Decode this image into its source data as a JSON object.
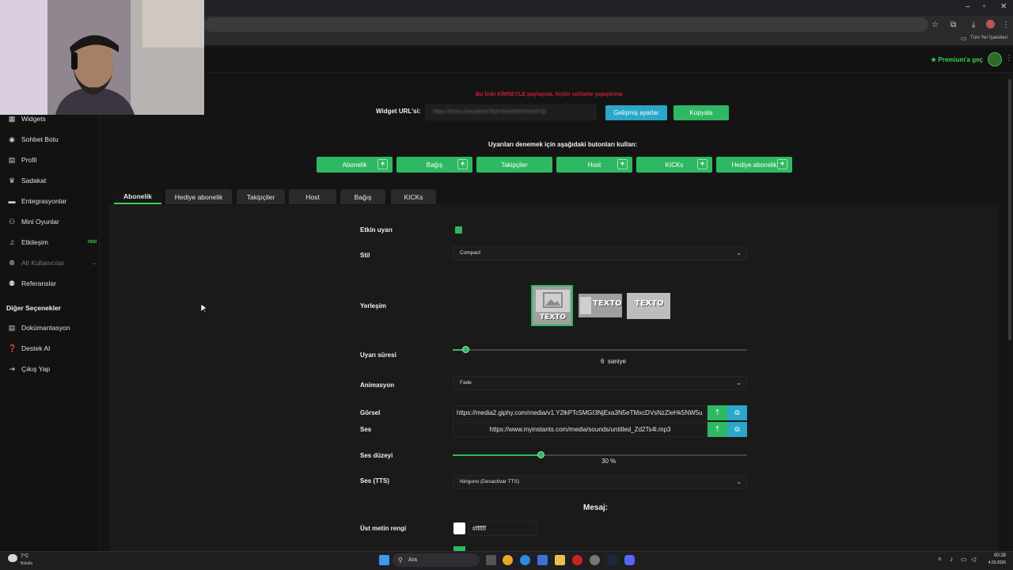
{
  "browser": {
    "bookmarks_label": "Tüm Yer İşaretleri"
  },
  "header": {
    "premium_label": "★ Premium'a geç"
  },
  "sidebar": {
    "items": [
      {
        "label": "Widgets",
        "icon": "grid-icon"
      },
      {
        "label": "Sohbet Botu",
        "icon": "bot-icon"
      },
      {
        "label": "Profil",
        "icon": "profile-card-icon"
      },
      {
        "label": "Sadakat",
        "icon": "trophy-icon"
      },
      {
        "label": "Entegrasyonlar",
        "icon": "integrations-icon"
      },
      {
        "label": "Mini Oyunlar",
        "icon": "gamepad-icon"
      },
      {
        "label": "Etkileşim",
        "icon": "music-note-icon",
        "badge": "YENİ"
      },
      {
        "label": "Alt Kullanıcılar",
        "icon": "users-icon",
        "disabled": true
      },
      {
        "label": "Referanslar",
        "icon": "referrals-icon"
      }
    ],
    "section_title": "Diğer Seçenekler",
    "other_items": [
      {
        "label": "Dokümantasyon",
        "icon": "docs-icon"
      },
      {
        "label": "Destek AI",
        "icon": "help-icon"
      },
      {
        "label": "Çıkış Yap",
        "icon": "logout-icon"
      }
    ]
  },
  "widget": {
    "warning": "Bu linki KİMSEYLE paylaşma, hiçbir sohbete yapıştırma",
    "url_label": "Widget URL'si:",
    "url_value": "https://botrix.live/alerts?bid=KecbMmPrmdYxjt",
    "advanced_button": "Gelişmiş ayarlar",
    "copy_button": "Kopyala",
    "test_label": "Uyarıları denemek için aşağıdaki butonları kullan:",
    "test_buttons": [
      "Abonelik",
      "Bağış",
      "Takipçiler",
      "Host",
      "KICKs",
      "Hediye abonelik"
    ]
  },
  "tabs": [
    "Abonelik",
    "Hediye abonelik",
    "Takipçiler",
    "Host",
    "Bağış",
    "KICKs"
  ],
  "form": {
    "active_label": "Etkin uyarı",
    "active": true,
    "style_label": "Stil",
    "style_value": "Compact",
    "layout_label": "Yerleşim",
    "layout_options": [
      "TEXTO",
      "TEXTO",
      "TEXTO"
    ],
    "duration_label": "Uyarı süresi",
    "duration_value": "6",
    "duration_unit": "saniye",
    "animation_label": "Animasyon",
    "animation_value": "Fade",
    "image_label": "Görsel",
    "image_value": "https://media2.giphy.com/media/v1.Y2lkPTc5MGI3NjExa3N5eTMxcDVsNzZleHk5NW5u",
    "sound_label": "Ses",
    "sound_value": "https://www.myinstants.com/media/sounds/untitled_Zd2Ts4l.mp3",
    "volume_label": "Ses düzeyi",
    "volume_value": "30",
    "volume_unit": "%",
    "volume_fraction": 0.3,
    "tts_label": "Ses (TTS)",
    "tts_value": "Ninguno (Desactivar TTS)",
    "message_title": "Mesaj:",
    "top_text_color_label": "Üst metin rengi",
    "top_text_color_value": "#ffffff"
  },
  "taskbar": {
    "weather_temp": "7°C",
    "weather_desc": "Bulutlu",
    "search_placeholder": "Ara",
    "time": "00:28",
    "date": "4.03.2026"
  },
  "colors": {
    "accent_green": "#2fb862",
    "accent_blue": "#2aa7c9",
    "warning_red": "#c81e3a"
  }
}
